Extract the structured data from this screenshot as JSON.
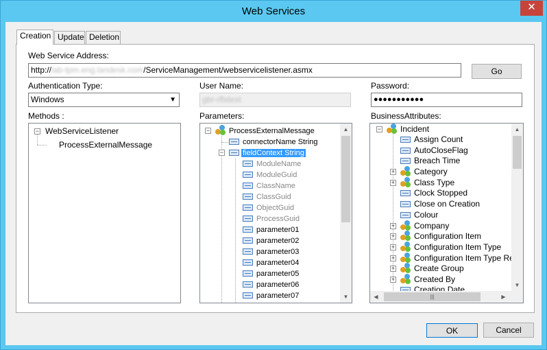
{
  "window": {
    "title": "Web Services",
    "close_glyph": "✕"
  },
  "tabs": [
    {
      "label": "Creation",
      "active": true
    },
    {
      "label": "Update",
      "active": false
    },
    {
      "label": "Deletion",
      "active": false
    }
  ],
  "form": {
    "address_label": "Web Service Address:",
    "address_value": "http://",
    "address_host_blurred": "lab-tpm.eng.landesk.com",
    "address_path": "/ServiceManagement/webservicelistener.asmx",
    "go_label": "Go",
    "auth_label": "Authentication Type:",
    "auth_value": "Windows",
    "username_label": "User Name:",
    "username_blurred": "gbr-rflxtest",
    "password_label": "Password:",
    "password_value": "●●●●●●●●●●●"
  },
  "methods": {
    "label": "Methods :",
    "root": "WebServiceListener",
    "children": [
      "ProcessExternalMessage"
    ]
  },
  "parameters": {
    "label": "Parameters:",
    "root": "ProcessExternalMessage",
    "items": [
      {
        "label": "connectorName String",
        "gray": false
      },
      {
        "label": "fieldContext String",
        "gray": false,
        "selected": true
      },
      {
        "label": "ModuleName",
        "gray": true
      },
      {
        "label": "ModuleGuid",
        "gray": true
      },
      {
        "label": "ClassName",
        "gray": true
      },
      {
        "label": "ClassGuid",
        "gray": true
      },
      {
        "label": "ObjectGuid",
        "gray": true
      },
      {
        "label": "ProcessGuid",
        "gray": true
      },
      {
        "label": "parameter01",
        "gray": false
      },
      {
        "label": "parameter02",
        "gray": false
      },
      {
        "label": "parameter03",
        "gray": false
      },
      {
        "label": "parameter04",
        "gray": false
      },
      {
        "label": "parameter05",
        "gray": false
      },
      {
        "label": "parameter06",
        "gray": false
      },
      {
        "label": "parameter07",
        "gray": false
      }
    ]
  },
  "business": {
    "label": "BusinessAttributes:",
    "root": "Incident",
    "items": [
      {
        "label": "Assign Count",
        "kind": "field"
      },
      {
        "label": "AutoCloseFlag",
        "kind": "field"
      },
      {
        "label": "Breach Time",
        "kind": "field"
      },
      {
        "label": "Category",
        "kind": "class"
      },
      {
        "label": "Class Type",
        "kind": "class"
      },
      {
        "label": "Clock Stopped",
        "kind": "field"
      },
      {
        "label": "Close on Creation",
        "kind": "field"
      },
      {
        "label": "Colour",
        "kind": "field"
      },
      {
        "label": "Company",
        "kind": "class"
      },
      {
        "label": "Configuration Item",
        "kind": "class"
      },
      {
        "label": "Configuration Item Type",
        "kind": "class"
      },
      {
        "label": "Configuration Item Type Refe",
        "kind": "class"
      },
      {
        "label": "Create Group",
        "kind": "class"
      },
      {
        "label": "Created By",
        "kind": "class"
      },
      {
        "label": "Creation Date",
        "kind": "field"
      }
    ],
    "hscroll_thumb_glyph": "|||"
  },
  "footer": {
    "ok_label": "OK",
    "cancel_label": "Cancel"
  }
}
